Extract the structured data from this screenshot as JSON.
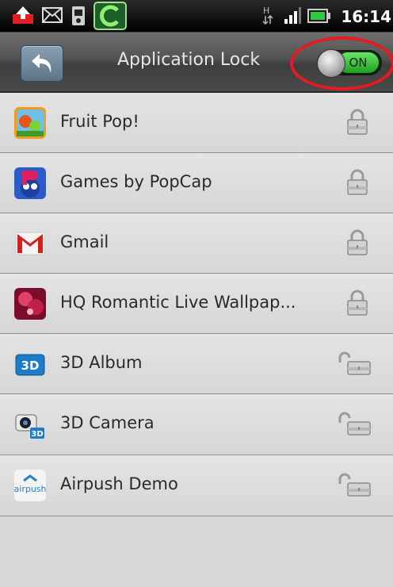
{
  "status_bar": {
    "clock": "16:14",
    "icons": [
      "upload-alert-icon",
      "mail-icon",
      "sd-card-icon",
      "comodo-icon",
      "data-arrows-icon",
      "signal-icon",
      "battery-icon"
    ]
  },
  "header": {
    "title": "Application Lock",
    "toggle_label": "ON",
    "toggle_state": "on",
    "back_icon": "back-arrow-icon"
  },
  "colors": {
    "highlight": "#e31b23",
    "toggle_green": "#1fa11f",
    "row_bg": "#e0e0e0"
  },
  "apps": [
    {
      "name": "Fruit Pop!",
      "icon": "fruit-pop-icon",
      "lock": "locked"
    },
    {
      "name": "Games by PopCap",
      "icon": "popcap-icon",
      "lock": "locked"
    },
    {
      "name": "Gmail",
      "icon": "gmail-icon",
      "lock": "locked"
    },
    {
      "name": "HQ Romantic Live Wallpap...",
      "icon": "wallpaper-icon",
      "lock": "locked"
    },
    {
      "name": "3D Album",
      "icon": "3d-album-icon",
      "lock": "unlocked"
    },
    {
      "name": "3D Camera",
      "icon": "3d-camera-icon",
      "lock": "unlocked"
    },
    {
      "name": "Airpush Demo",
      "icon": "airpush-icon",
      "lock": "unlocked"
    }
  ]
}
